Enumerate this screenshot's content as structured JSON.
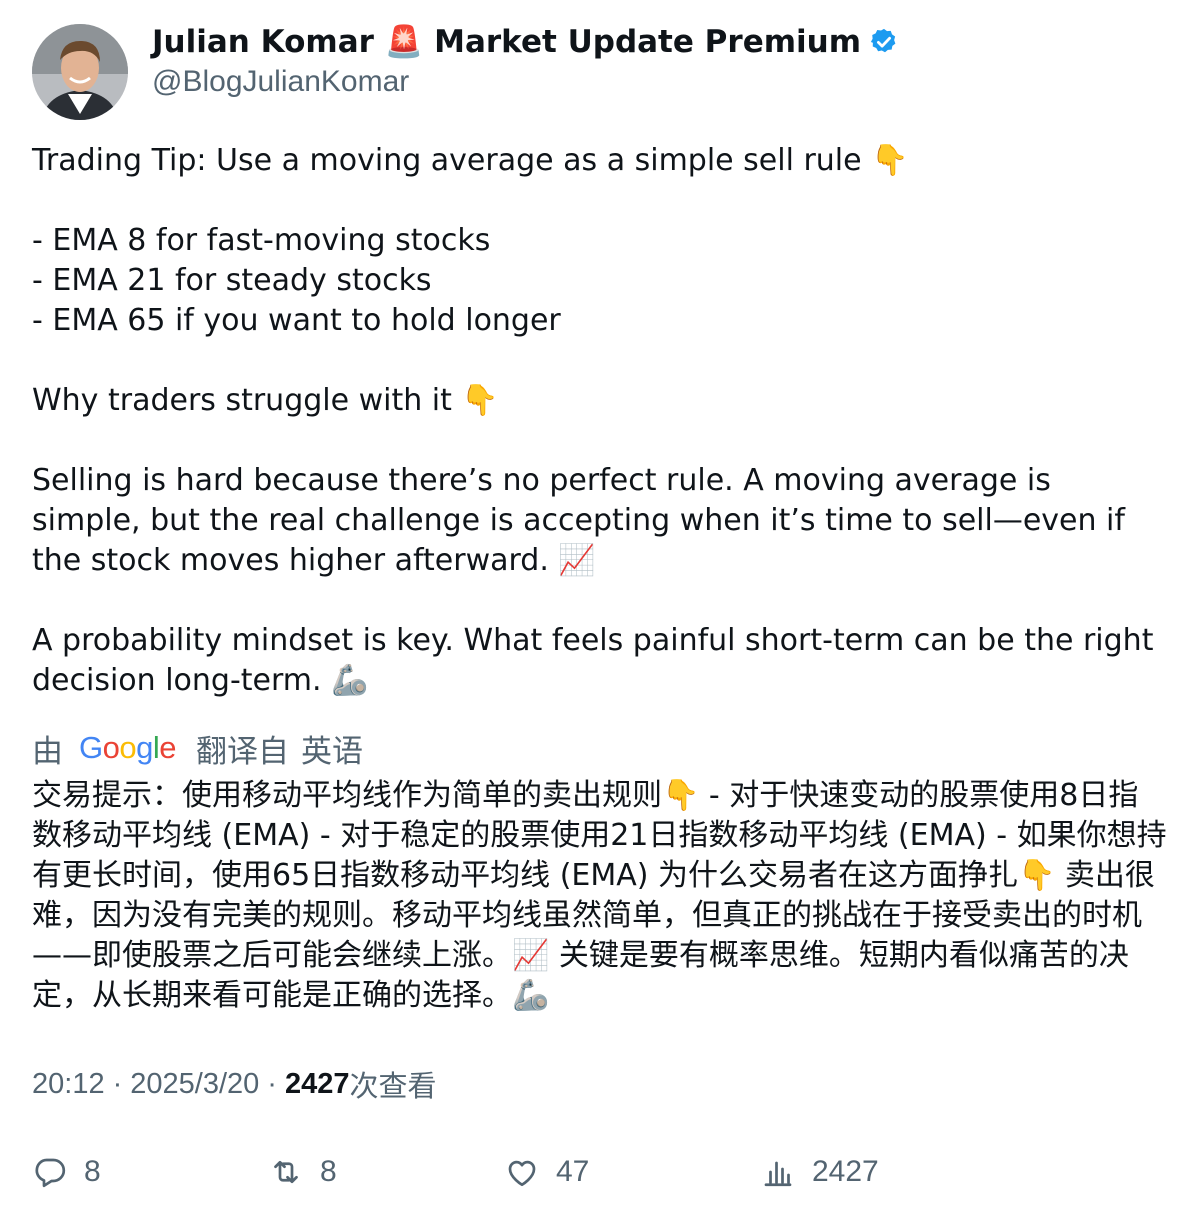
{
  "author": {
    "display_name": "Julian Komar 🚨 Market Update Premium",
    "handle": "@BlogJulianKomar",
    "verified_color": "#1d9bf0"
  },
  "tweet": {
    "text": "Trading Tip: Use a moving average as a simple sell rule 👇\n\n- EMA 8 for fast-moving stocks\n- EMA 21 for steady stocks\n- EMA 65 if you want to hold longer\n\nWhy traders struggle with it 👇\n\nSelling is hard because there’s no perfect rule. A moving average is simple, but the real challenge is accepting when it’s time to sell—even if the stock moves higher afterward. 📈\n\nA probability mindset is key. What feels painful short-term can be the right decision long-term. 🦾"
  },
  "translation": {
    "by_label": "由",
    "google_label": "Google",
    "from_label": "翻译自",
    "language": "英语",
    "text": "交易提示：使用移动平均线作为简单的卖出规则👇 - 对于快速变动的股票使用8日指数移动平均线 (EMA) - 对于稳定的股票使用21日指数移动平均线 (EMA) - 如果你想持有更长时间，使用65日指数移动平均线 (EMA) 为什么交易者在这方面挣扎👇 卖出很难，因为没有完美的规则。移动平均线虽然简单，但真正的挑战在于接受卖出的时机——即使股票之后可能会继续上涨。📈 关键是要有概率思维。短期内看似痛苦的决定，从长期来看可能是正确的选择。🦾"
  },
  "meta": {
    "time": "20:12",
    "separator": "·",
    "date": "2025/3/20",
    "views_count": "2427",
    "views_label": "次查看"
  },
  "actions": {
    "reply_count": "8",
    "retweet_count": "8",
    "like_count": "47",
    "views_count": "2427"
  },
  "icons": [
    "verified-badge-icon",
    "reply-icon",
    "retweet-icon",
    "like-icon",
    "views-icon"
  ]
}
